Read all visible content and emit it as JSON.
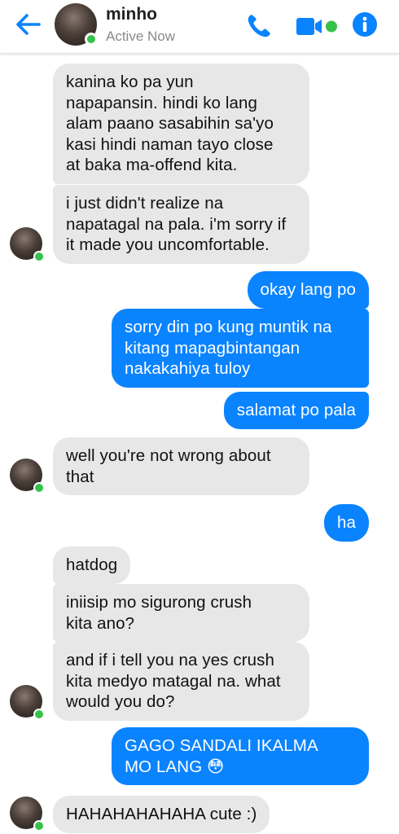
{
  "header": {
    "back_icon": "back-arrow-icon",
    "contact_name": "minho",
    "status": "Active Now",
    "accent": "#0a83ff",
    "online_color": "#36c24a"
  },
  "messages": [
    {
      "side": "in",
      "text": "kanina ko pa yun\nnapapansin. hindi ko lang\nalam paano sasabihin sa'yo\nkasi hindi naman tayo close\nat baka ma-offend kita."
    },
    {
      "side": "in",
      "text": "i just didn't realize na\nnapatagal na pala. i'm sorry if\nit made you uncomfortable."
    },
    {
      "side": "out",
      "text": "okay lang po"
    },
    {
      "side": "out",
      "text": "sorry din po kung muntik na\nkitang mapagbintangan\nnakakahiya tuloy"
    },
    {
      "side": "out",
      "text": "salamat po pala"
    },
    {
      "side": "in",
      "text": "well you're not wrong about\nthat"
    },
    {
      "side": "out",
      "text": "ha"
    },
    {
      "side": "in",
      "text": "hatdog"
    },
    {
      "side": "in",
      "text": "iniisip mo sigurong crush\nkita ano?"
    },
    {
      "side": "in",
      "text": "and if i tell you na yes crush\nkita medyo matagal na. what\nwould you do?"
    },
    {
      "side": "out",
      "text": "GAGO SANDALI IKALMA\nMO LANG 😳"
    },
    {
      "side": "in",
      "text": "HAHAHAHAHAHA cute :)"
    }
  ]
}
